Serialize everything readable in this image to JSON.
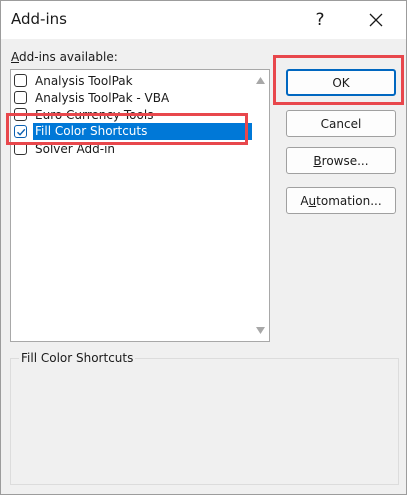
{
  "window": {
    "title": "Add-ins",
    "help_glyph": "?",
    "close_icon": "close-icon"
  },
  "addins_list": {
    "label_mnemonic": "A",
    "label_rest": "dd-ins available:",
    "items": [
      {
        "label": "Analysis ToolPak",
        "checked": false,
        "selected": false
      },
      {
        "label": "Analysis ToolPak - VBA",
        "checked": false,
        "selected": false
      },
      {
        "label": "Euro Currency Tools",
        "checked": false,
        "selected": false
      },
      {
        "label": "Fill Color Shortcuts",
        "checked": true,
        "selected": true
      },
      {
        "label": "Solver Add-in",
        "checked": false,
        "selected": false
      }
    ]
  },
  "description": {
    "label": "Fill Color Shortcuts"
  },
  "buttons": {
    "ok": "OK",
    "cancel": "Cancel",
    "browse_mnemonic": "B",
    "browse_rest": "rowse...",
    "automation_mnemonic": "u",
    "automation_pre": "A",
    "automation_rest": "tomation..."
  },
  "colors": {
    "selection": "#0078d7",
    "highlight": "#e8474c",
    "default_button_border": "#0067c0"
  }
}
